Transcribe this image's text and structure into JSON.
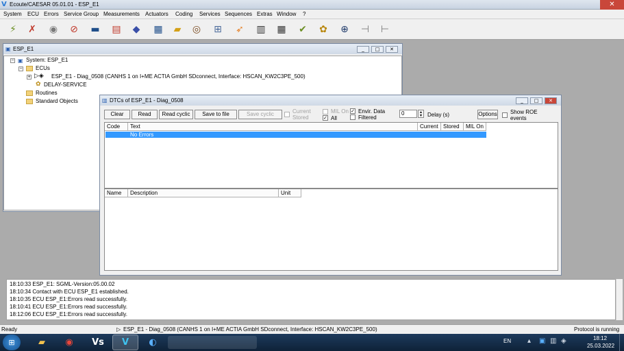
{
  "app": {
    "title": "Ecoute/CAESAR 05.01.01 - ESP_E1",
    "logo": "V",
    "close": "✕"
  },
  "menu": [
    "System",
    "ECU",
    "Errors",
    "Service Group",
    "Measurements",
    "Actuators",
    "Coding",
    "Services",
    "Sequences",
    "Extras",
    "Window",
    "?"
  ],
  "toolbar_icons": [
    "connect-icon",
    "disconnect-icon",
    "check-icon",
    "clear-icon",
    "ecu-icon",
    "fault-memory-icon",
    "car-icon",
    "measure-icon",
    "folder-icon",
    "eye-icon",
    "network-icon",
    "flash-icon",
    "document-icon",
    "table-icon",
    "folder-check-icon",
    "tools-icon",
    "binoculars-icon",
    "plug-icon",
    "unplug-icon"
  ],
  "tree_window": {
    "title": "ESP_E1",
    "nodes": {
      "system": "System: ESP_E1",
      "ecus": "ECUs",
      "ecu": "ESP_E1 - Diag_0508 (CANHS 1 on I+ME ACTIA GmbH SDconnect, Interface: HSCAN_KW2C3PE_500)",
      "delay": "DELAY-SERVICE",
      "routines": "Routines",
      "standard": "Standard Objects"
    }
  },
  "dtc_window": {
    "title": "DTCs of ESP_E1 - Diag_0508",
    "buttons": {
      "clear": "Clear",
      "read": "Read",
      "read_cyclic": "Read cyclic",
      "save": "Save to file",
      "save_cyclic": "Save cyclic",
      "options": "Options"
    },
    "checks": {
      "current": "Current",
      "stored": "Stored",
      "mil_on": "MIL On",
      "all": "All",
      "envir": "Envir. Data",
      "filtered": "Filtered",
      "show_roe_1": "Show ROE",
      "show_roe_2": "events"
    },
    "delay_value": "0",
    "delay_label": "Delay (s)",
    "dtc_columns": [
      "Code",
      "Text",
      "Current",
      "Stored",
      "MIL On"
    ],
    "dtc_rows": [
      {
        "code": "",
        "text": "No Errors",
        "current": "",
        "stored": "",
        "mil": ""
      }
    ],
    "env_columns": [
      "Name",
      "Description",
      "Unit"
    ]
  },
  "log": [
    "18:10:33 ESP_E1: SGML-Version:05.00.02",
    "18:10:34 Contact with ECU ESP_E1 established.",
    "18:10:35 ECU ESP_E1:Errors read successfully.",
    "18:10:41 ECU ESP_E1:Errors read successfully.",
    "18:12:06 ECU ESP_E1:Errors read successfully."
  ],
  "status": {
    "left": "Ready",
    "center": "ESP_E1 - Diag_0508 (CANHS 1 on I+ME ACTIA GmbH SDconnect, Interface: HSCAN_KW2C3PE_500)",
    "right": "Protocol is running"
  },
  "taskbar": {
    "lang": "EN",
    "time": "18:12",
    "date": "25.03.2022"
  },
  "colors": {
    "selection": "#3399ff",
    "accent": "#2b7bd6"
  }
}
